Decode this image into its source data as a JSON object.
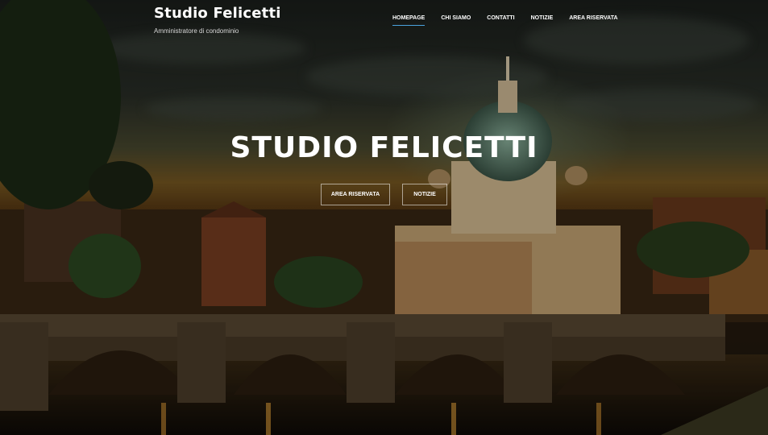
{
  "site": {
    "title": "Studio Felicetti",
    "tagline": "Amministratore di condominio"
  },
  "nav": {
    "items": [
      {
        "label": "HOMEPAGE",
        "active": true
      },
      {
        "label": "CHI SIAMO",
        "active": false
      },
      {
        "label": "CONTATTI",
        "active": false
      },
      {
        "label": "NOTIZIE",
        "active": false
      },
      {
        "label": "AREA RISERVATA",
        "active": false
      }
    ],
    "accent_color": "#4aa3df"
  },
  "hero": {
    "heading": "STUDIO FELICETTI",
    "buttons": [
      {
        "label": "AREA RISERVATA"
      },
      {
        "label": "NOTIZIE"
      }
    ]
  }
}
